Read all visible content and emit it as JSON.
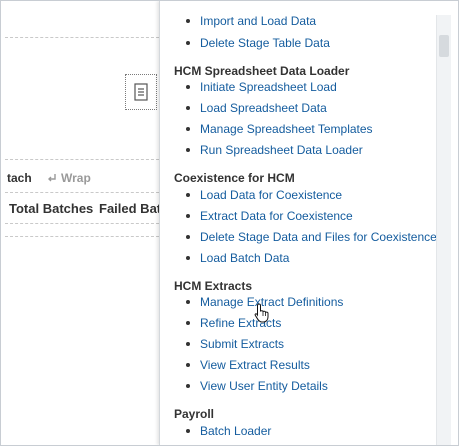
{
  "background": {
    "toolbar_partial": "tach",
    "wrap_label": "Wrap",
    "columns": [
      "Total Batches",
      "Failed Batc"
    ]
  },
  "menu": {
    "partial_item": "Import and Load Data",
    "groups": [
      {
        "title": "",
        "items": [
          "Delete Stage Table Data"
        ]
      },
      {
        "title": "HCM Spreadsheet Data Loader",
        "items": [
          "Initiate Spreadsheet Load",
          "Load Spreadsheet Data",
          "Manage Spreadsheet Templates",
          "Run Spreadsheet Data Loader"
        ]
      },
      {
        "title": "Coexistence for HCM",
        "items": [
          "Load Data for Coexistence",
          "Extract Data for Coexistence",
          "Delete Stage Data and Files for Coexistence",
          "Load Batch Data"
        ]
      },
      {
        "title": "HCM Extracts",
        "items": [
          "Manage Extract Definitions",
          "Refine Extracts",
          "Submit Extracts",
          "View Extract Results",
          "View User Entity Details"
        ]
      },
      {
        "title": "Payroll",
        "items": [
          "Batch Loader"
        ]
      }
    ]
  },
  "colors": {
    "link": "#145c9e",
    "heading": "#333333"
  }
}
